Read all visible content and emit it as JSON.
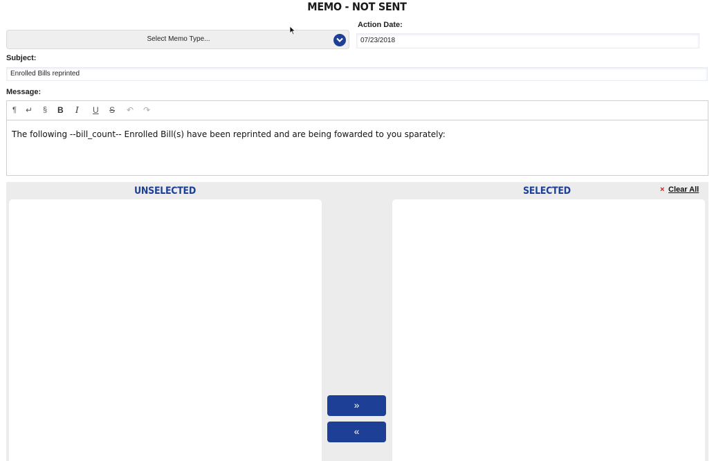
{
  "page": {
    "title": "MEMO - NOT SENT"
  },
  "memo_type": {
    "placeholder": "Select Memo Type..."
  },
  "action_date": {
    "label": "Action Date:",
    "value": "07/23/2018"
  },
  "subject": {
    "label": "Subject:",
    "value": "Enrolled Bills reprinted"
  },
  "message": {
    "label": "Message:",
    "toolbar": {
      "paragraph": "¶",
      "line_break": "↵",
      "section": "§",
      "bold": "B",
      "italic": "I",
      "underline": "U",
      "strike": "S",
      "undo": "↶",
      "redo": "↷"
    },
    "body": "The following --bill_count-- Enrolled Bill(s) have been reprinted and are being fowarded to you sparately:"
  },
  "lists": {
    "unselected_title": "UNSELECTED",
    "selected_title": "SELECTED",
    "clear_x": "×",
    "clear_all": "Clear All",
    "move_right": "»",
    "move_left": "«"
  },
  "colors": {
    "accent": "#1e3f96",
    "clear_x": "#d02020",
    "panel_bg": "#ececec"
  }
}
